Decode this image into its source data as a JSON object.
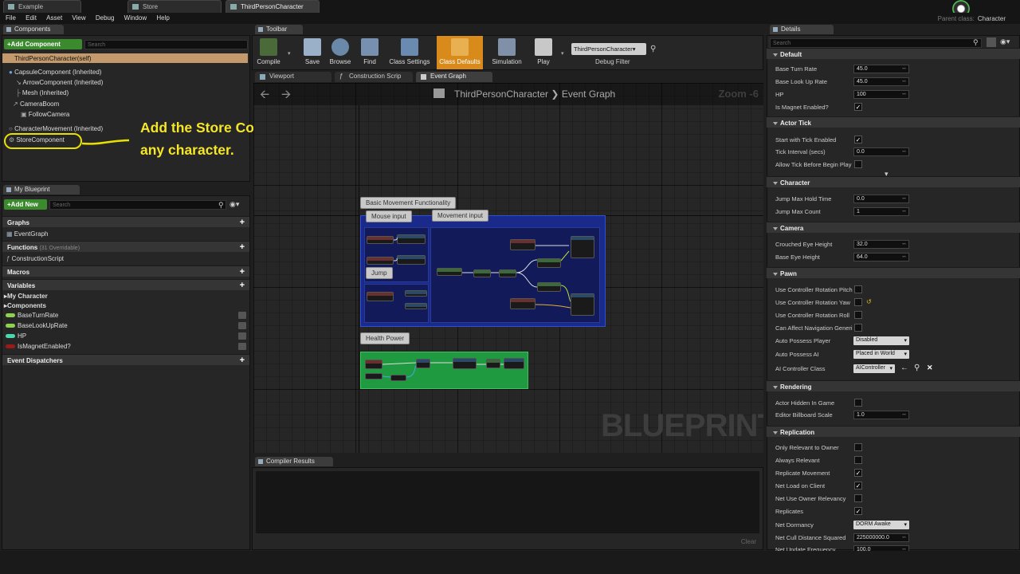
{
  "tabs": [
    {
      "label": "Example"
    },
    {
      "label": "Store"
    },
    {
      "label": "ThirdPersonCharacter"
    }
  ],
  "menu": [
    "File",
    "Edit",
    "Asset",
    "View",
    "Debug",
    "Window",
    "Help"
  ],
  "parent_class": {
    "label": "Parent class:",
    "value": "Character"
  },
  "components_panel": {
    "tab": "Components",
    "add_button": "+Add Component",
    "search_placeholder": "Search",
    "root": "ThirdPersonCharacter(self)",
    "items": [
      "CapsuleComponent (Inherited)",
      "ArrowComponent (Inherited)",
      "Mesh (Inherited)",
      "CameraBoom",
      "FollowCamera",
      "CharacterMovement (Inherited)",
      "StoreComponent"
    ]
  },
  "annotation": {
    "line1": "Add the Store Component to",
    "line2": "any character."
  },
  "my_blueprint": {
    "tab": "My Blueprint",
    "add_button": "+Add New",
    "search_placeholder": "Search",
    "graphs": "Graphs",
    "event_graph": "EventGraph",
    "functions": "Functions",
    "functions_count": "(31 Overridable)",
    "construction_script": "ConstructionScript",
    "macros": "Macros",
    "variables": "Variables",
    "my_character": "My Character",
    "components": "Components",
    "vars": [
      {
        "name": "BaseTurnRate",
        "color": "#8fd14f"
      },
      {
        "name": "BaseLookUpRate",
        "color": "#8fd14f"
      },
      {
        "name": "HP",
        "color": "#47d9ad"
      },
      {
        "name": "IsMagnetEnabled?",
        "color": "#9a1a1a"
      }
    ],
    "event_dispatchers": "Event Dispatchers"
  },
  "toolbar": {
    "tab": "Toolbar",
    "buttons": [
      "Compile",
      "Save",
      "Browse",
      "Find",
      "Class Settings",
      "Class Defaults",
      "Simulation",
      "Play"
    ],
    "debug_select": "ThirdPersonCharacter▾",
    "debug_filter": "Debug Filter"
  },
  "graph_tabs": [
    "Viewport",
    "Construction Scrip",
    "Event Graph"
  ],
  "graph": {
    "breadcrumb_root": "ThirdPersonCharacter",
    "breadcrumb_sep": "❯",
    "breadcrumb_leaf": "Event Graph",
    "zoom": "Zoom -6",
    "watermark": "BLUEPRINT",
    "comments": {
      "basic": "Basic Movement Functionality",
      "mouse": "Mouse input",
      "movement": "Movement input",
      "jump": "Jump",
      "health": "Health Power"
    }
  },
  "compiler": {
    "tab": "Compiler Results",
    "clear": "Clear"
  },
  "details": {
    "tab": "Details",
    "search_placeholder": "Search",
    "sections": {
      "default": "Default",
      "actor_tick": "Actor Tick",
      "character": "Character",
      "camera": "Camera",
      "pawn": "Pawn",
      "rendering": "Rendering",
      "replication": "Replication"
    },
    "props": {
      "base_turn_rate": {
        "label": "Base Turn Rate",
        "value": "45.0"
      },
      "base_look_up_rate": {
        "label": "Base Look Up Rate",
        "value": "45.0"
      },
      "hp": {
        "label": "HP",
        "value": "100"
      },
      "is_magnet": {
        "label": "Is Magnet Enabled?",
        "checked": true
      },
      "start_tick": {
        "label": "Start with Tick Enabled",
        "checked": true
      },
      "tick_interval": {
        "label": "Tick Interval (secs)",
        "value": "0.0"
      },
      "allow_tick": {
        "label": "Allow Tick Before Begin Play",
        "checked": false
      },
      "jump_hold": {
        "label": "Jump Max Hold Time",
        "value": "0.0"
      },
      "jump_count": {
        "label": "Jump Max Count",
        "value": "1"
      },
      "crouched_eye": {
        "label": "Crouched Eye Height",
        "value": "32.0"
      },
      "base_eye": {
        "label": "Base Eye Height",
        "value": "64.0"
      },
      "use_pitch": {
        "label": "Use Controller Rotation Pitch",
        "checked": false
      },
      "use_yaw": {
        "label": "Use Controller Rotation Yaw",
        "checked": false
      },
      "use_roll": {
        "label": "Use Controller Rotation Roll",
        "checked": false
      },
      "can_affect_nav": {
        "label": "Can Affect Navigation Generi",
        "checked": false
      },
      "auto_possess_player": {
        "label": "Auto Possess Player",
        "value": "Disabled"
      },
      "auto_possess_ai": {
        "label": "Auto Possess AI",
        "value": "Placed in World"
      },
      "ai_controller": {
        "label": "AI Controller Class",
        "value": "AIController"
      },
      "actor_hidden": {
        "label": "Actor Hidden In Game",
        "checked": false
      },
      "billboard_scale": {
        "label": "Editor Billboard Scale",
        "value": "1.0"
      },
      "only_relevant": {
        "label": "Only Relevant to Owner",
        "checked": false
      },
      "always_relevant": {
        "label": "Always Relevant",
        "checked": false
      },
      "replicate_movement": {
        "label": "Replicate Movement",
        "checked": true
      },
      "net_load": {
        "label": "Net Load on Client",
        "checked": true
      },
      "net_owner": {
        "label": "Net Use Owner Relevancy",
        "checked": false
      },
      "replicates": {
        "label": "Replicates",
        "checked": true
      },
      "net_dormancy": {
        "label": "Net Dormancy",
        "value": "DORM Awake"
      },
      "net_cull": {
        "label": "Net Cull Distance Squared",
        "value": "225000000.0"
      },
      "net_update": {
        "label": "Net Update Frequency",
        "value": "100.0"
      }
    }
  }
}
